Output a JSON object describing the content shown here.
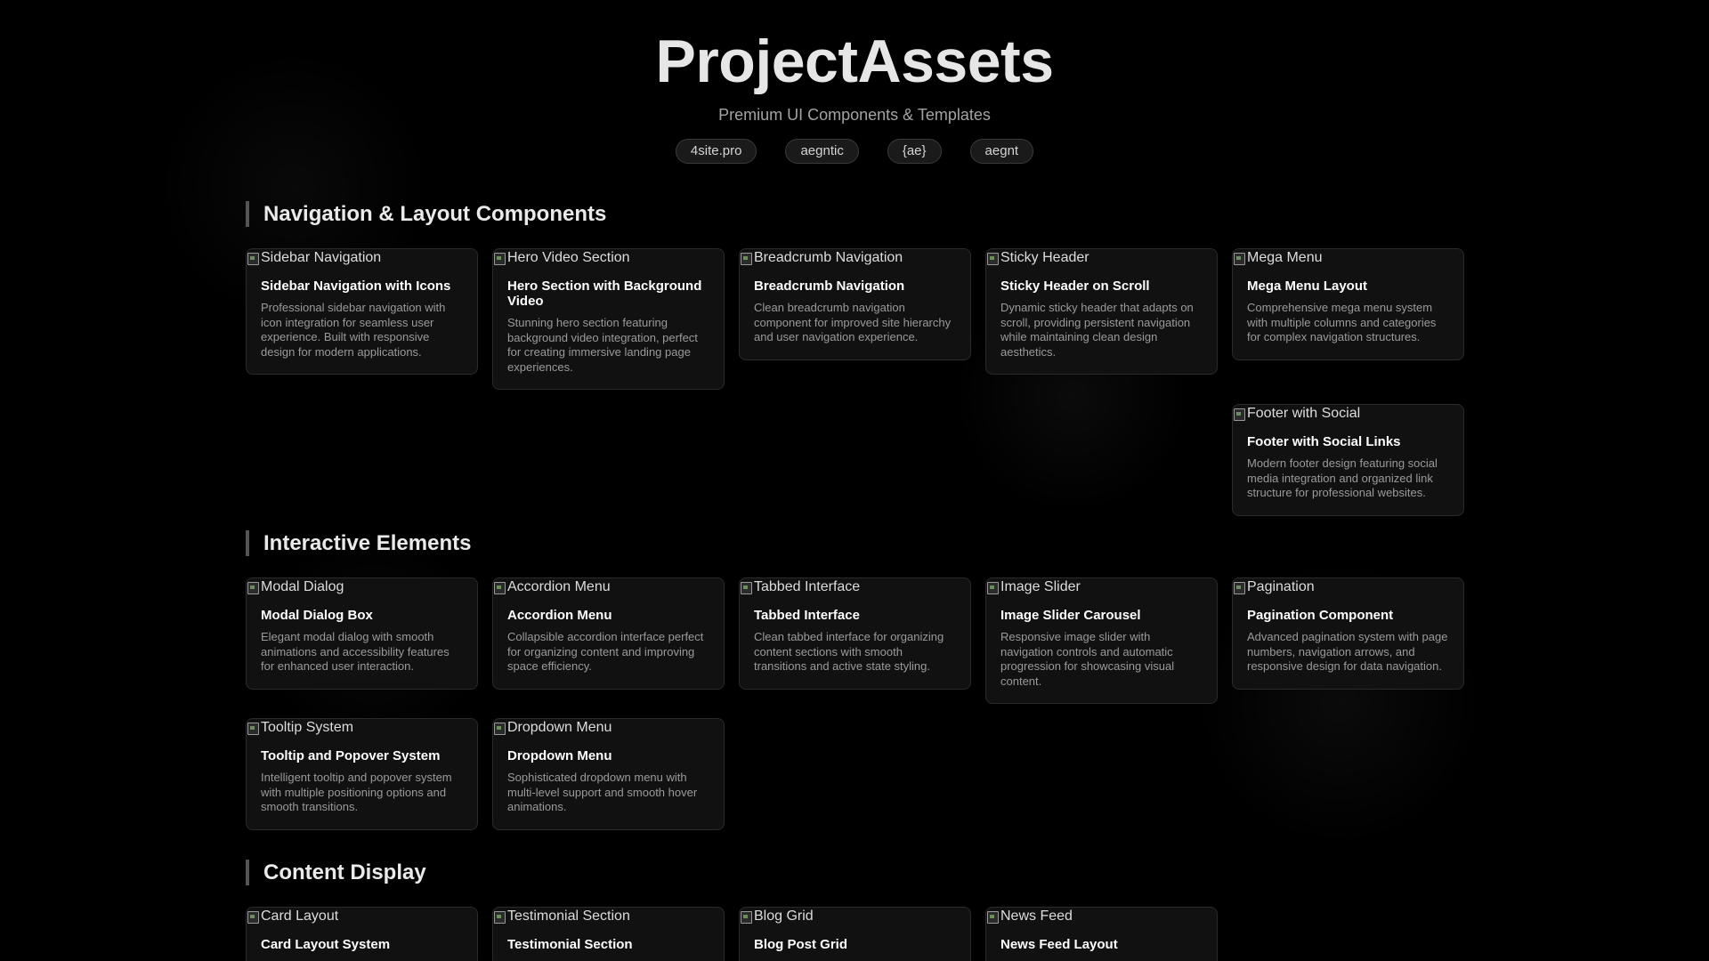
{
  "header": {
    "title": "ProjectAssets",
    "subtitle": "Premium UI Components & Templates",
    "tags": [
      "4site.pro",
      "aegntic",
      "{ae}",
      "aegnt"
    ]
  },
  "sections": [
    {
      "title": "Navigation & Layout Components",
      "cards": [
        {
          "image_alt": "Sidebar Navigation",
          "title": "Sidebar Navigation with Icons",
          "description": "Professional sidebar navigation with icon integration for seamless user experience. Built with responsive design for modern applications."
        },
        {
          "image_alt": "Hero Video Section",
          "title": "Hero Section with Background Video",
          "description": "Stunning hero section featuring background video integration, perfect for creating immersive landing page experiences."
        },
        {
          "image_alt": "Breadcrumb Navigation",
          "title": "Breadcrumb Navigation",
          "description": "Clean breadcrumb navigation component for improved site hierarchy and user navigation experience."
        },
        {
          "image_alt": "Sticky Header",
          "title": "Sticky Header on Scroll",
          "description": "Dynamic sticky header that adapts on scroll, providing persistent navigation while maintaining clean design aesthetics."
        },
        {
          "image_alt": "Mega Menu",
          "title": "Mega Menu Layout",
          "description": "Comprehensive mega menu system with multiple columns and categories for complex navigation structures."
        },
        {
          "image_alt": "Footer with Social",
          "title": "Footer with Social Links",
          "description": "Modern footer design featuring social media integration and organized link structure for professional websites."
        }
      ]
    },
    {
      "title": "Interactive Elements",
      "cards": [
        {
          "image_alt": "Modal Dialog",
          "title": "Modal Dialog Box",
          "description": "Elegant modal dialog with smooth animations and accessibility features for enhanced user interaction."
        },
        {
          "image_alt": "Accordion Menu",
          "title": "Accordion Menu",
          "description": "Collapsible accordion interface perfect for organizing content and improving space efficiency."
        },
        {
          "image_alt": "Tabbed Interface",
          "title": "Tabbed Interface",
          "description": "Clean tabbed interface for organizing content sections with smooth transitions and active state styling."
        },
        {
          "image_alt": "Image Slider",
          "title": "Image Slider Carousel",
          "description": "Responsive image slider with navigation controls and automatic progression for showcasing visual content."
        },
        {
          "image_alt": "Pagination",
          "title": "Pagination Component",
          "description": "Advanced pagination system with page numbers, navigation arrows, and responsive design for data navigation."
        },
        {
          "image_alt": "Tooltip System",
          "title": "Tooltip and Popover System",
          "description": "Intelligent tooltip and popover system with multiple positioning options and smooth transitions."
        },
        {
          "image_alt": "Dropdown Menu",
          "title": "Dropdown Menu",
          "description": "Sophisticated dropdown menu with multi-level support and smooth hover animations."
        }
      ]
    },
    {
      "title": "Content Display",
      "cards": [
        {
          "image_alt": "Card Layout",
          "title": "Card Layout System",
          "description": ""
        },
        {
          "image_alt": "Testimonial Section",
          "title": "Testimonial Section",
          "description": ""
        },
        {
          "image_alt": "Blog Grid",
          "title": "Blog Post Grid",
          "description": ""
        },
        {
          "image_alt": "News Feed",
          "title": "News Feed Layout",
          "description": ""
        }
      ]
    }
  ]
}
